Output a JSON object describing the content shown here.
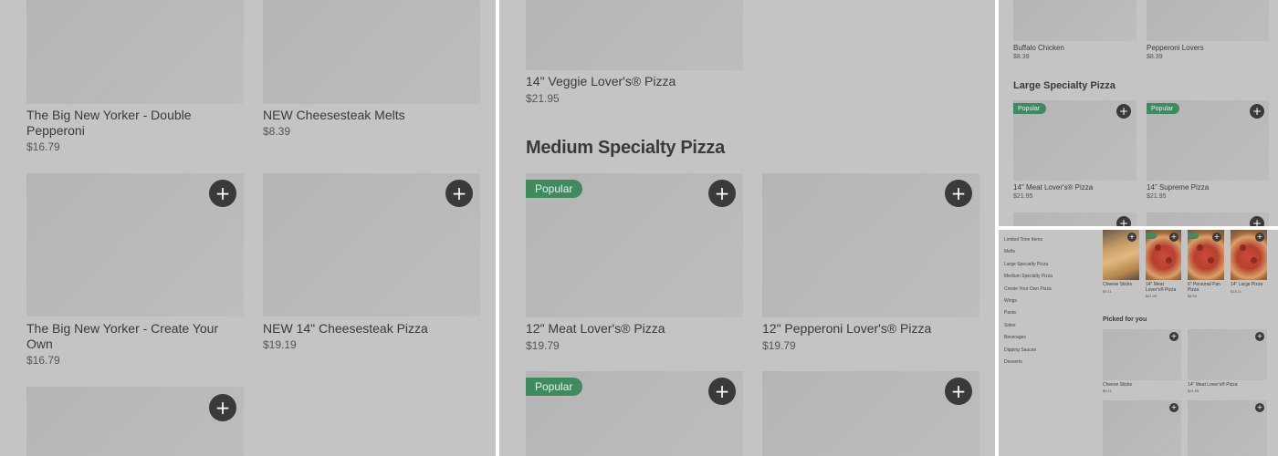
{
  "panel1": {
    "items": [
      {
        "name": "The Big New Yorker - Double Pepperoni",
        "price": "$16.79"
      },
      {
        "name": "NEW Cheesesteak Melts",
        "price": "$8.39"
      },
      {
        "name": "The Big New Yorker - Create Your Own",
        "price": "$16.79"
      },
      {
        "name": "NEW 14\" Cheesesteak Pizza",
        "price": "$19.19"
      }
    ],
    "add_glyph": "+"
  },
  "panel2": {
    "top_item": {
      "name": "14\" Veggie Lover's® Pizza",
      "price": "$21.95"
    },
    "section_title": "Medium Specialty Pizza",
    "items": [
      {
        "name": "12\" Meat Lover's® Pizza",
        "price": "$19.79",
        "badge": "Popular"
      },
      {
        "name": "12\" Pepperoni Lover's® Pizza",
        "price": "$19.79"
      }
    ],
    "next_badge": "Popular",
    "add_glyph": "+"
  },
  "panel3": {
    "top_items": [
      {
        "name": "Buffalo Chicken",
        "price": "$8.39"
      },
      {
        "name": "Pepperoni Lovers",
        "price": "$8.39"
      }
    ],
    "section_title": "Large Specialty Pizza",
    "items": [
      {
        "name": "14\" Meat Lover's® Pizza",
        "price": "$21.95",
        "badge": "Popular"
      },
      {
        "name": "14\" Supreme Pizza",
        "price": "$21.95",
        "badge": "Popular"
      }
    ],
    "add_glyph": "+"
  },
  "panel4": {
    "categories": [
      "Limited Time Items",
      "Melts",
      "Large Specialty Pizza",
      "Medium Specialty Pizza",
      "Create Your Own Pizza",
      "Wings",
      "Pasta",
      "Sides",
      "Beverages",
      "Dipping Sauces",
      "Desserts"
    ],
    "featured": [
      {
        "name": "Cheese Sticks",
        "price": "$9.11"
      },
      {
        "name": "14\" Meat Lover's® Pizza",
        "price": "$21.95"
      },
      {
        "name": "6\" Personal Pan Pizza",
        "price": "$8.59"
      },
      {
        "name": "14\" Large Pizza",
        "price": "$18.11"
      }
    ],
    "section_title": "Picked for you",
    "picked": [
      {
        "name": "Cheese Sticks",
        "price": "$9.11"
      },
      {
        "name": "14\" Meat Lover's® Pizza",
        "price": "$21.95"
      }
    ],
    "add_glyph": "+"
  }
}
